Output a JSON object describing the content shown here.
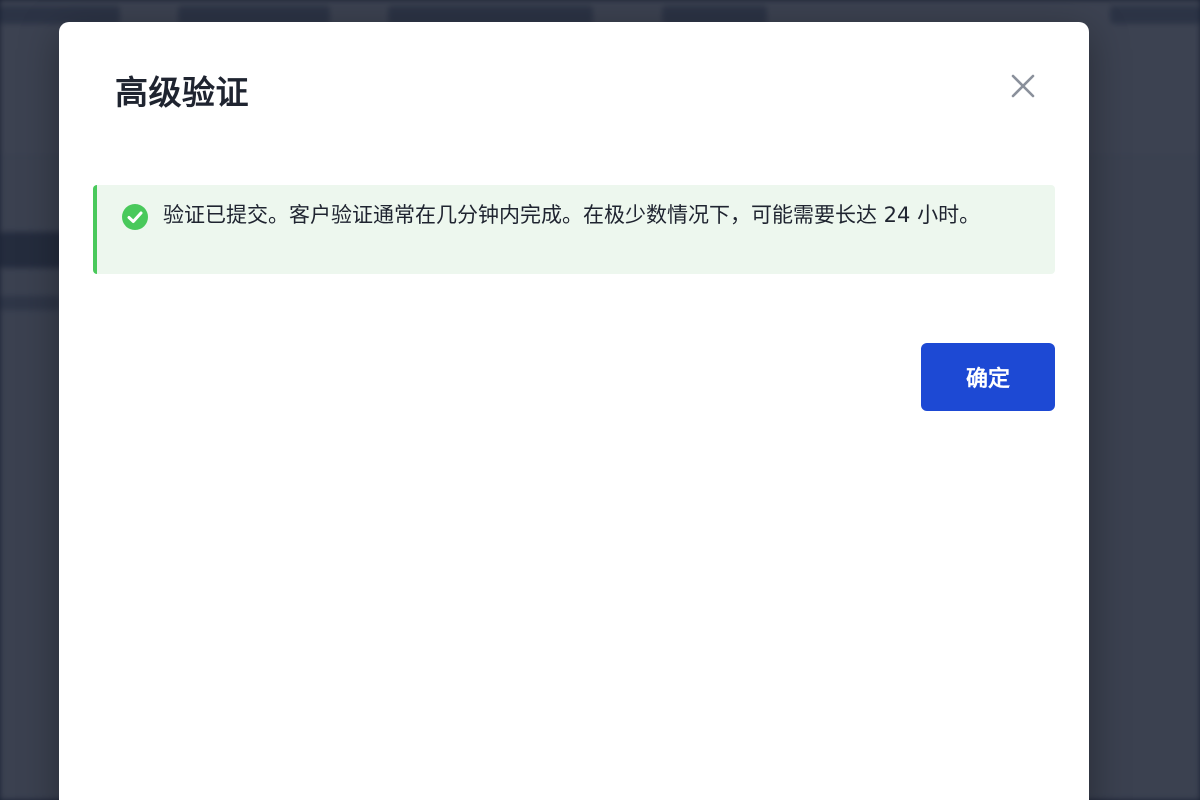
{
  "modal": {
    "title": "高级验证",
    "close_icon": "close-icon",
    "alert": {
      "icon": "check-circle-icon",
      "message": "验证已提交。客户验证通常在几分钟内完成。在极少数情况下，可能需要长达 24 小时。",
      "color": "#49c95b",
      "background": "#edf7ee"
    },
    "confirm_label": "确定",
    "confirm_color": "#1d49d4"
  }
}
